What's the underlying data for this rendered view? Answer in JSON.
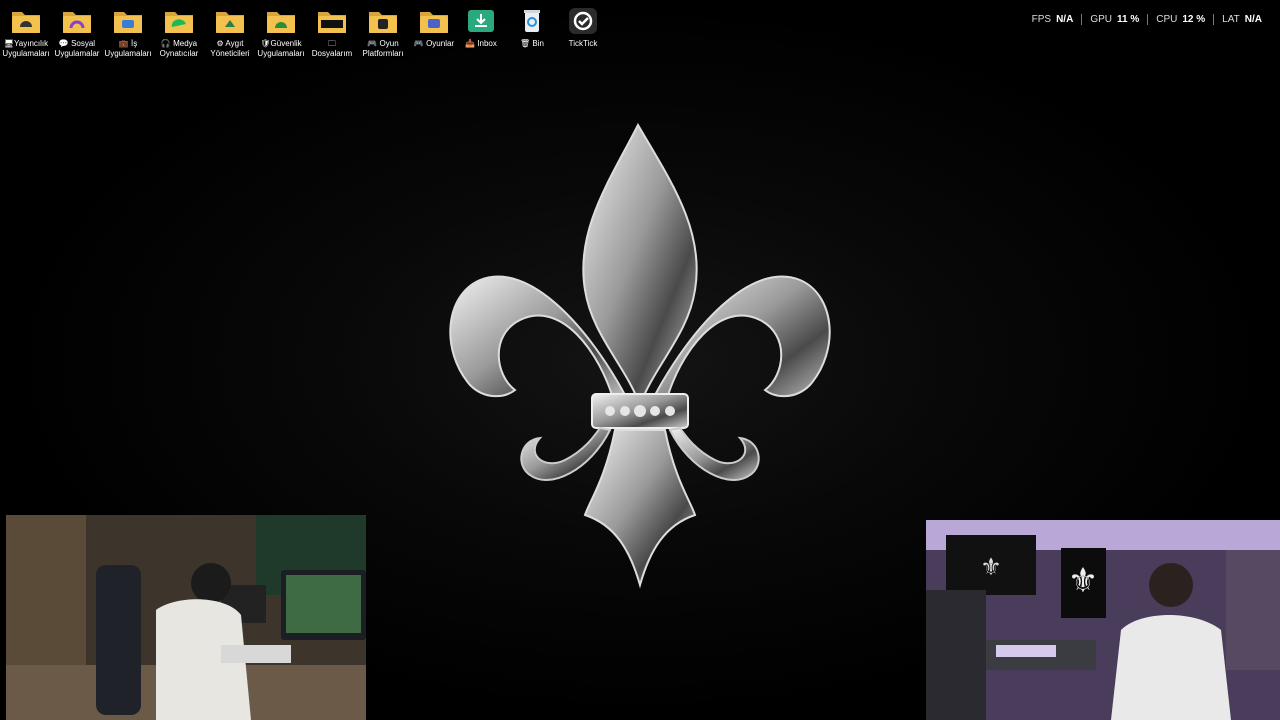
{
  "desktop": {
    "icons": [
      {
        "label": "🖥Yayıncılık\nUygulamaları",
        "icon": "folder-streaming-icon"
      },
      {
        "label": "💬 Sosyal\nUygulamalar",
        "icon": "folder-social-icon"
      },
      {
        "label": "💼 İş\nUygulamaları",
        "icon": "folder-work-icon"
      },
      {
        "label": "🎧 Medya\nOynatıcılar",
        "icon": "folder-media-icon"
      },
      {
        "label": "⚙ Aygıt\nYöneticileri",
        "icon": "folder-device-icon"
      },
      {
        "label": "🛡Güvenlik\nUygulamaları",
        "icon": "folder-security-icon"
      },
      {
        "label": "🗀\nDosyalarım",
        "icon": "folder-files-icon"
      },
      {
        "label": "🎮 Oyun\nPlatformları",
        "icon": "folder-platforms-icon"
      },
      {
        "label": "🎮 Oyunlar",
        "icon": "folder-games-icon"
      },
      {
        "label": "📥 Inbox",
        "icon": "inbox-icon"
      },
      {
        "label": "🗑 Bin",
        "icon": "recycle-bin-icon"
      },
      {
        "label": "TickTick",
        "icon": "ticktick-icon"
      }
    ]
  },
  "stats": {
    "fps": {
      "label": "FPS",
      "value": "N/A"
    },
    "gpu": {
      "label": "GPU",
      "value": "11 %"
    },
    "cpu": {
      "label": "CPU",
      "value": "12 %"
    },
    "lat": {
      "label": "LAT",
      "value": "N/A"
    }
  },
  "colors": {
    "folder": "#f2c14e",
    "folder_dark": "#d9a53a",
    "inbox": "#2aa87e",
    "ticktick": "#2b2b2b"
  }
}
